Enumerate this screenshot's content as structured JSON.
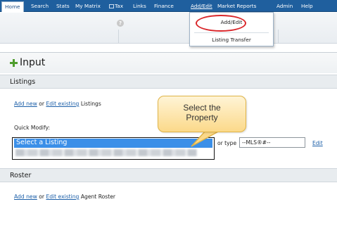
{
  "nav": {
    "items": [
      "Home",
      "Search",
      "Stats",
      "My Matrix",
      "Tax",
      "Links",
      "Finance",
      "Add/Edit",
      "Market Reports",
      "Admin",
      "Help"
    ]
  },
  "dropdown": {
    "items": [
      "Add/Edit",
      "Listing Transfer"
    ]
  },
  "input": {
    "title": "Input"
  },
  "listings": {
    "section_title": "Listings",
    "add_new": "Add new",
    "or": "or",
    "edit_existing": "Edit existing",
    "suffix": "Listings",
    "quick_modify_label": "Quick Modify:",
    "select_placeholder": "Select a Listing",
    "or_type": "or type",
    "mls_value": "--MLS®#--",
    "edit": "Edit"
  },
  "callout": {
    "line1": "Select the",
    "line2": "Property"
  },
  "roster": {
    "section_title": "Roster",
    "add_new": "Add new",
    "or": "or",
    "edit_existing": "Edit existing",
    "suffix": "Agent Roster"
  },
  "colors": {
    "nav_bg": "#1f5f9e",
    "selection_blue": "#3b8fe8",
    "highlight_red": "#d9262a",
    "callout_fill": "#fbd98a",
    "link_blue": "#1c5fa8"
  }
}
